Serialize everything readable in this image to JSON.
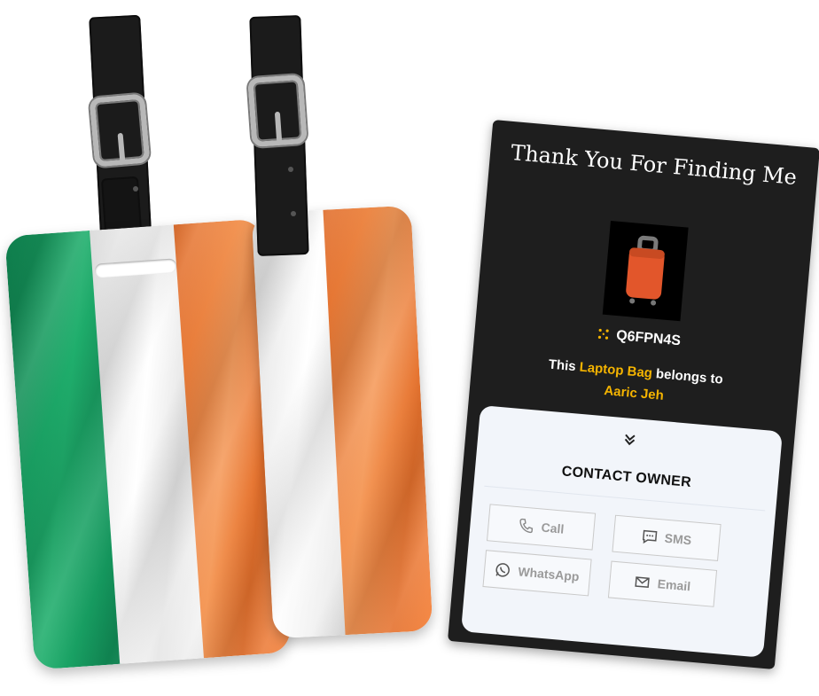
{
  "card": {
    "title": "Thank You For Finding Me",
    "tag_code": "Q6FPN4S",
    "owner_line": {
      "prefix": "This",
      "item": "Laptop Bag",
      "middle": "belongs to",
      "owner": "Aaric Jeh"
    },
    "contact": {
      "heading": "CONTACT OWNER",
      "buttons": {
        "call": "Call",
        "sms": "SMS",
        "whatsapp": "WhatsApp",
        "email": "Email"
      }
    }
  },
  "colors": {
    "flag_green": "#169b62",
    "flag_white": "#f4f4f4",
    "flag_orange": "#f4853b",
    "card_bg": "#1e1e1e",
    "highlight": "#f5b400",
    "bag": "#e2562b"
  },
  "icons": [
    "chevron-double-down-icon",
    "phone-icon",
    "chat-bubble-icon",
    "whatsapp-icon",
    "envelope-icon",
    "qr-dots-icon",
    "suitcase-icon"
  ]
}
